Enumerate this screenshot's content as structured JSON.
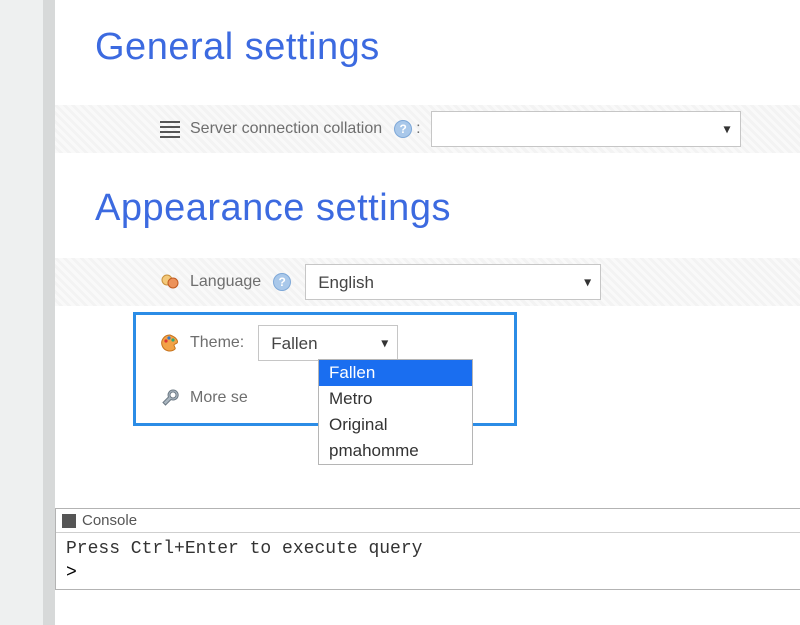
{
  "headings": {
    "general": "General settings",
    "appearance": "Appearance settings"
  },
  "collation": {
    "label": "Server connection collation",
    "value": ""
  },
  "language": {
    "label": "Language",
    "value": "English"
  },
  "theme": {
    "label": "Theme:",
    "value": "Fallen",
    "options": [
      "Fallen",
      "Metro",
      "Original",
      "pmahomme"
    ],
    "selected_index": 0
  },
  "more_settings": {
    "label": "More se"
  },
  "console": {
    "title": "Console",
    "hint": "Press Ctrl+Enter to execute query",
    "prompt": ">"
  },
  "help_glyph": "?"
}
